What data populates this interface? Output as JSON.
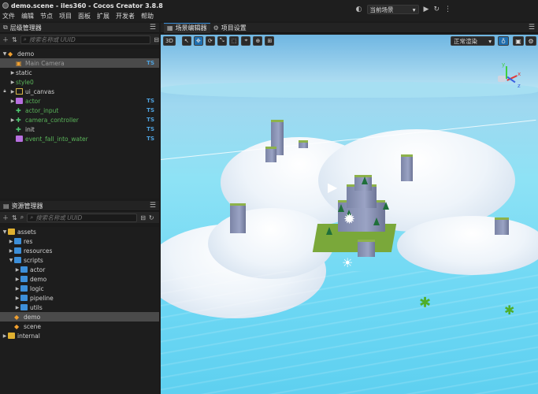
{
  "window": {
    "title": "demo.scene - iles360 - Cocos Creator 3.8.8"
  },
  "menu": [
    "文件",
    "编辑",
    "节点",
    "项目",
    "面板",
    "扩展",
    "开发者",
    "帮助"
  ],
  "top_toolbar": {
    "scene_select": "当前场景"
  },
  "hierarchy": {
    "title": "层级管理器",
    "search_placeholder": "搜索名称或 UUID",
    "nodes": [
      {
        "label": "demo",
        "ts": ""
      },
      {
        "label": "Main Camera",
        "ts": "TS"
      },
      {
        "label": "static",
        "ts": ""
      },
      {
        "label": "style0",
        "ts": ""
      },
      {
        "label": "ui_canvas",
        "ts": ""
      },
      {
        "label": "actor",
        "ts": "TS"
      },
      {
        "label": "actor_input",
        "ts": "TS"
      },
      {
        "label": "camera_controller",
        "ts": "TS"
      },
      {
        "label": "init",
        "ts": "TS"
      },
      {
        "label": "event_fall_into_water",
        "ts": "TS"
      }
    ]
  },
  "assets": {
    "title": "资源管理器",
    "search_placeholder": "搜索名称或 UUID",
    "items": [
      {
        "label": "assets"
      },
      {
        "label": "res"
      },
      {
        "label": "resources"
      },
      {
        "label": "scripts"
      },
      {
        "label": "actor"
      },
      {
        "label": "demo"
      },
      {
        "label": "logic"
      },
      {
        "label": "pipeline"
      },
      {
        "label": "utils"
      },
      {
        "label": "demo"
      },
      {
        "label": "scene"
      },
      {
        "label": "internal"
      }
    ]
  },
  "scene_panel": {
    "tabs": [
      {
        "label": "场景编辑器",
        "active": true
      },
      {
        "label": "项目设置",
        "active": false
      }
    ],
    "mode_3d": "3D",
    "render_mode": "正常渲染",
    "gizmo": {
      "x": "x",
      "y": "y",
      "z": "z"
    }
  },
  "colors": {
    "accent": "#1f6fb0",
    "ts_badge": "#4fa3e0",
    "script_green": "#5ab55a",
    "selection": "#4a4a4a"
  }
}
